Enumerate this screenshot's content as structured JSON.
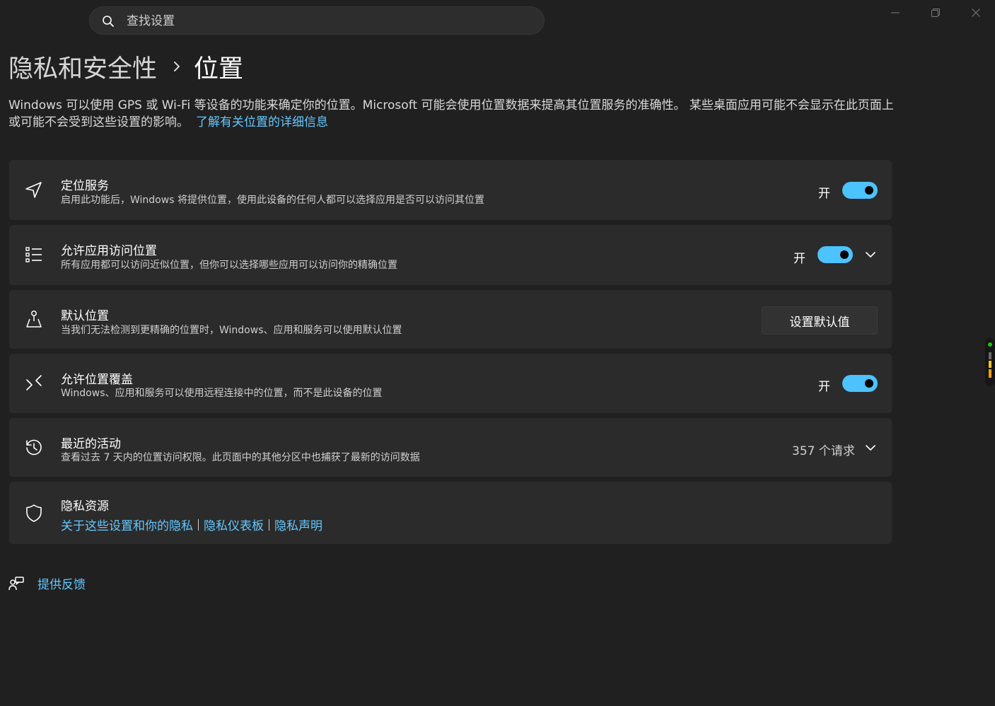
{
  "search": {
    "placeholder": "查找设置"
  },
  "window": {
    "minimize_icon": "minimize-icon",
    "restore_icon": "restore-icon",
    "close_icon": "close-icon"
  },
  "breadcrumb": {
    "parent": "隐私和安全性",
    "current": "位置"
  },
  "description": {
    "text": "Windows 可以使用 GPS 或 Wi-Fi 等设备的功能来确定你的位置。Microsoft 可能会使用位置数据来提高其位置服务的准确性。 某些桌面应用可能不会显示在此页面上或可能不会受到这些设置的影响。",
    "link": "了解有关位置的详细信息"
  },
  "settings": [
    {
      "icon": "location-arrow-icon",
      "title": "定位服务",
      "subtitle": "启用此功能后，Windows 将提供位置，使用此设备的任何人都可以选择应用是否可以访问其位置",
      "state": "开",
      "on": true
    },
    {
      "icon": "app-list-icon",
      "title": "允许应用访问位置",
      "subtitle": "所有应用都可以访问近似位置，但你可以选择哪些应用可以访问你的精确位置",
      "state": "开",
      "on": true
    },
    {
      "icon": "default-location-icon",
      "title": "默认位置",
      "subtitle": "当我们无法检测到更精确的位置时，Windows、应用和服务可以使用默认位置",
      "button": "设置默认值"
    },
    {
      "icon": "location-override-icon",
      "title": "允许位置覆盖",
      "subtitle": "Windows、应用和服务可以使用远程连接中的位置，而不是此设备的位置",
      "state": "开",
      "on": true
    },
    {
      "icon": "history-icon",
      "title": "最近的活动",
      "subtitle": "查看过去 7 天内的位置访问权限。此页面中的其他分区中也捕获了最新的访问数据",
      "value": "357 个请求"
    },
    {
      "icon": "shield-icon",
      "title": "隐私资源",
      "links": [
        "关于这些设置和你的隐私",
        "隐私仪表板",
        "隐私声明"
      ]
    }
  ],
  "feedback": {
    "icon": "feedback-icon",
    "label": "提供反馈"
  },
  "colors": {
    "background": "#202020",
    "card": "#2b2b2b",
    "accent": "#4cc2ff",
    "link": "#64c8ff"
  }
}
